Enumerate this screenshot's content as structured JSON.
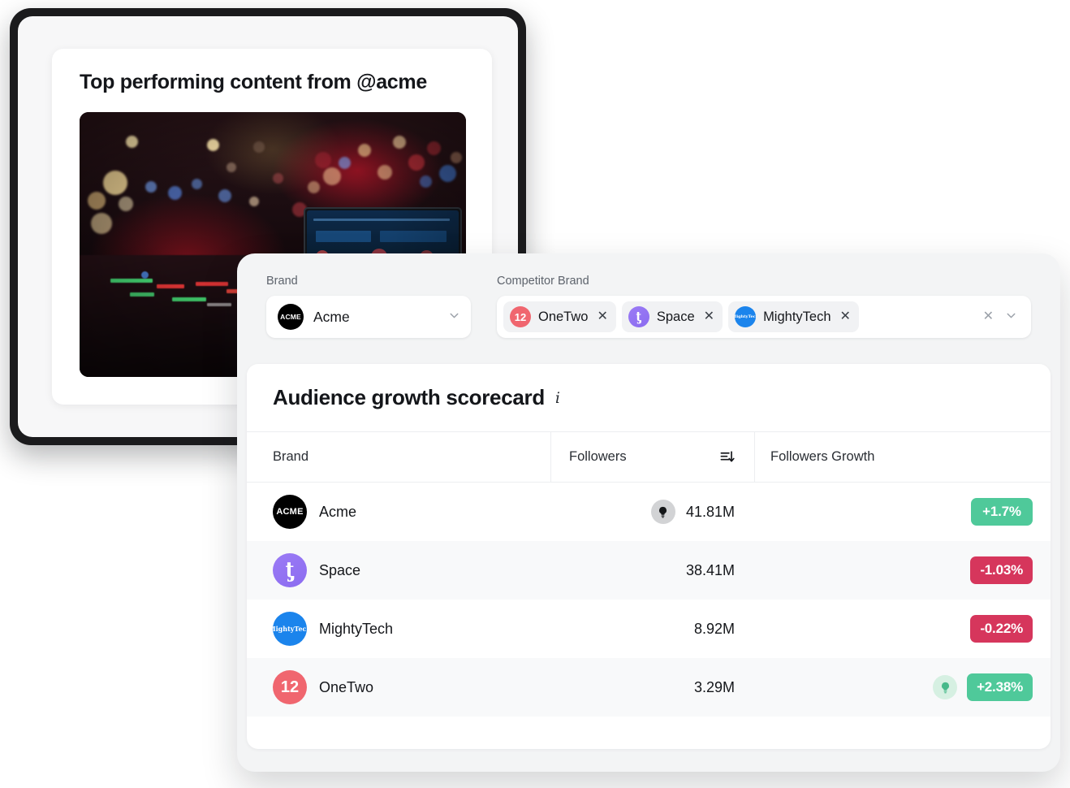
{
  "left_card": {
    "title": "Top performing content from @acme",
    "photo_alt": "nightclub-dj-booth-photo"
  },
  "filters": {
    "brand": {
      "label": "Brand",
      "selected": "Acme",
      "avatar_text": "ACME",
      "avatar_color": "#000000",
      "chevron_icon": "chevron-down-icon"
    },
    "competitors": {
      "label": "Competitor Brand",
      "chips": [
        {
          "name": "OneTwo",
          "avatar_text": "12",
          "avatar_color": "#f0666f",
          "remove_icon": "close-icon"
        },
        {
          "name": "Space",
          "avatar_text": "ƫ",
          "avatar_color": "#8b6cf0",
          "remove_icon": "close-icon"
        },
        {
          "name": "MightyTech",
          "avatar_text": "MightyTech",
          "avatar_color": "#1b84ec",
          "remove_icon": "close-icon"
        }
      ],
      "clear_icon": "close-icon",
      "chevron_icon": "chevron-down-icon"
    }
  },
  "scorecard": {
    "title": "Audience growth scorecard",
    "info_icon": "info-icon",
    "columns": {
      "brand": "Brand",
      "followers": "Followers",
      "followers_growth": "Followers Growth"
    },
    "sort_icon": "sort-descending-icon",
    "rows": [
      {
        "brand": "Acme",
        "avatar_text": "ACME",
        "avatar_color": "#000000",
        "followers": "41.81M",
        "growth": "+1.7%",
        "growth_direction": "up",
        "growth_color": "#4fc99a",
        "followers_insight_icon": "lightbulb-icon",
        "growth_insight_icon": null
      },
      {
        "brand": "Space",
        "avatar_text": "ƫ",
        "avatar_color": "#8b6cf0",
        "followers": "38.41M",
        "growth": "-1.03%",
        "growth_direction": "down",
        "growth_color": "#d6365c",
        "followers_insight_icon": null,
        "growth_insight_icon": null
      },
      {
        "brand": "MightyTech",
        "avatar_text": "MightyTech",
        "avatar_color": "#1b84ec",
        "followers": "8.92M",
        "growth": "-0.22%",
        "growth_direction": "down",
        "growth_color": "#d6365c",
        "followers_insight_icon": null,
        "growth_insight_icon": null
      },
      {
        "brand": "OneTwo",
        "avatar_text": "12",
        "avatar_color": "#f0666f",
        "followers": "3.29M",
        "growth": "+2.38%",
        "growth_direction": "up",
        "growth_color": "#4fc99a",
        "followers_insight_icon": null,
        "growth_insight_icon": "lightbulb-icon"
      }
    ]
  }
}
